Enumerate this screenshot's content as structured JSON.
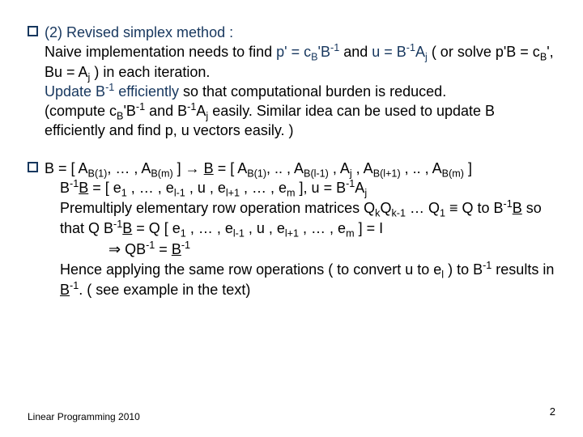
{
  "block1": {
    "lead": "(2) Revised simplex method :",
    "line2a": "Naive implementation needs to find ",
    "line2b": "p' = c",
    "line2b_sub": "B",
    "line2c": "'B",
    "line2c_sup": "-1",
    "line2d": "  and  ",
    "line2e": "u = B",
    "line2e_sup": "-1",
    "line2f": "A",
    "line2f_sub": "j",
    "line2g": " ( or solve p'B = c",
    "line2g_sub": "B",
    "line2h": "', Bu = A",
    "line2h_sub": "j",
    "line2i": " ) in each iteration.",
    "line3a": "Update B",
    "line3a_sup": "-1",
    "line3b": " efficiently ",
    "line3c": "so that computational burden is reduced.",
    "line4a": "(compute  c",
    "line4a_sub": "B",
    "line4b": "'B",
    "line4b_sup": "-1",
    "line4c": "  and  B",
    "line4c_sup": "-1",
    "line4d": "A",
    "line4d_sub": "j",
    "line4e": " easily.  Similar idea can be used to update B efficiently and find p, u vectors easily. )"
  },
  "block2": {
    "l1a": "B = [ A",
    "l1a_sub": "B(1)",
    "l1b": ",  … , A",
    "l1b_sub": "B(m)",
    "l1c": " ]  →  ",
    "l1d": "B",
    "l1e": " = [ A",
    "l1e_sub": "B(1)",
    "l1f": ", .. , A",
    "l1f_sub": "B(l-1)",
    "l1g": " , A",
    "l1g_sub": "j",
    "l1h": " , A",
    "l1h_sub": "B(l+1)",
    "l1i": " , .. , A",
    "l1i_sub": "B(m)",
    "l1j": " ]",
    "l2a": "B",
    "l2a_sup": "-1",
    "l2b": "B",
    "l2c": " = [ e",
    "l2c_sub": "1",
    "l2d": " , … , e",
    "l2d_sub": "l-1",
    "l2e": " , u , e",
    "l2e_sub": "l+1",
    "l2f": " , … , e",
    "l2f_sub": "m",
    "l2g": " ],   u = B",
    "l2g_sup": "-1",
    "l2h": "A",
    "l2h_sub": "j",
    "l3a": "Premultiply elementary row operation matrices Q",
    "l3a_sub": "k",
    "l3b": "Q",
    "l3b_sub": "k-1",
    "l3c": " … Q",
    "l3c_sub": "1",
    "l3d": " ≡ Q  to B",
    "l3d_sup": "-1",
    "l3e": "B",
    "l3f": "  so that   Q B",
    "l3f_sup": "-1",
    "l3g": "B",
    "l3h": " = Q [ e",
    "l3h_sub": "1",
    "l3i": " , … , e",
    "l3i_sub": "l-1",
    "l3j": " , u , e",
    "l3j_sub": "l+1",
    "l3k": " , … , e",
    "l3k_sub": "m",
    "l3l": " ] = I",
    "l4a": "⇒  QB",
    "l4a_sup": "-1",
    "l4b": " = ",
    "l4c": "B",
    "l4c_sup": "-1",
    "l5a": "Hence applying the same row operations ( to convert u to e",
    "l5a_sub": "l",
    "l5b": " ) to B",
    "l5b_sup": "-1",
    "l5c": " results in  ",
    "l5d": "B",
    "l5d_sup": "-1",
    "l5e": ".   ( see example in the text)"
  },
  "footer": "Linear Programming 2010",
  "page": "2"
}
